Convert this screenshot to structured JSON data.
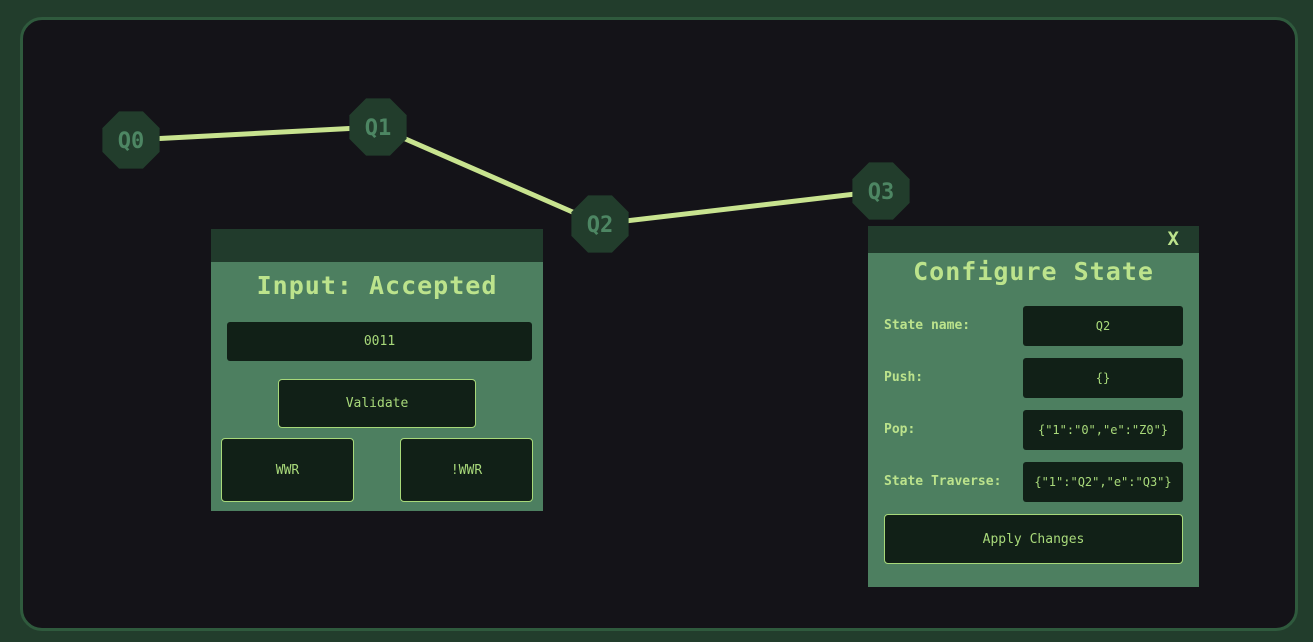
{
  "graph": {
    "nodes": [
      {
        "id": "Q0"
      },
      {
        "id": "Q1"
      },
      {
        "id": "Q2"
      },
      {
        "id": "Q3"
      }
    ],
    "edges": [
      [
        "Q0",
        "Q1"
      ],
      [
        "Q1",
        "Q2"
      ],
      [
        "Q2",
        "Q3"
      ]
    ]
  },
  "input_panel": {
    "title": "Input: Accepted",
    "input_value": "0011",
    "validate_label": "Validate",
    "wwr_label": "WWR",
    "not_wwr_label": "!WWR"
  },
  "config_panel": {
    "close_label": "X",
    "title": "Configure State",
    "fields": [
      {
        "label": "State name:",
        "value": "Q2"
      },
      {
        "label": "Push:",
        "value": "{}"
      },
      {
        "label": "Pop:",
        "value": "{\"1\":\"0\",\"e\":\"Z0\"}"
      },
      {
        "label": "State Traverse:",
        "value": "{\"1\":\"Q2\",\"e\":\"Q3\"}"
      }
    ],
    "apply_label": "Apply Changes"
  },
  "colors": {
    "background": "#141318",
    "frame": "#223d2c",
    "node_fill": "#223d2c",
    "edge": "#c8e38f",
    "panel": "#4d7f60",
    "accent_text": "#bce38c"
  }
}
